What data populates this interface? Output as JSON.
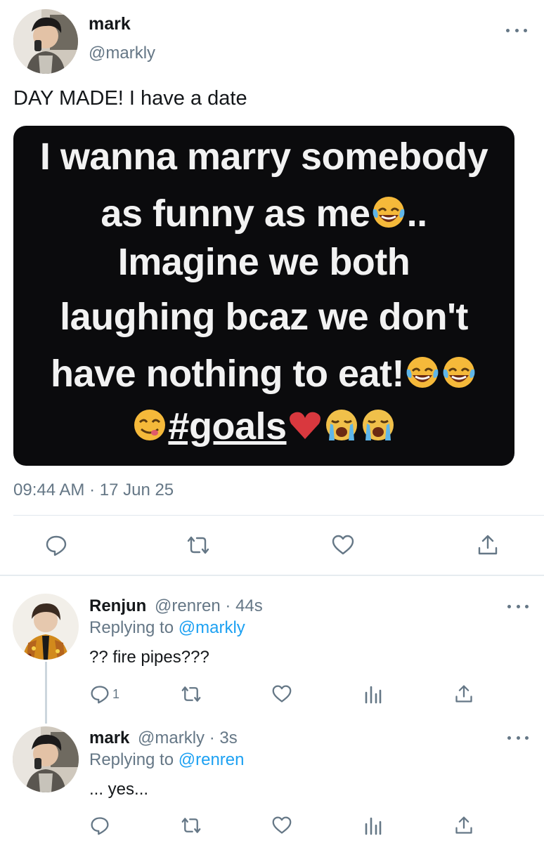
{
  "main_tweet": {
    "display_name": "mark",
    "handle": "@markly",
    "text": "DAY MADE! I have a date",
    "image_text": {
      "line1": "I wanna marry somebody",
      "line2": "as funny as me",
      "line2_tail": "..",
      "line3": "Imagine we both",
      "line4": "laughing bcaz we don't",
      "line5": "have nothing to eat!",
      "line6": "#goals"
    },
    "timestamp": "09:44 AM · 17 Jun 25"
  },
  "replies": [
    {
      "display_name": "Renjun",
      "handle_time": "@renren · 44s",
      "replying_label": "Replying to",
      "replying_to": "@markly",
      "text": "?? fire pipes???",
      "reply_count": "1"
    },
    {
      "display_name": "mark",
      "handle_time": "@markly · 3s",
      "replying_label": "Replying to",
      "replying_to": "@renren",
      "text": "... yes..."
    }
  ],
  "icons": {
    "more": "more-horizontal-icon",
    "reply": "speech-bubble-icon",
    "retweet": "retweet-icon",
    "like": "heart-icon",
    "share": "share-upload-icon",
    "analytics": "bar-chart-icon"
  },
  "colors": {
    "link": "#1da1f2",
    "secondary_text": "#657786",
    "primary_text": "#14171a",
    "divider": "#e1e8ed"
  }
}
